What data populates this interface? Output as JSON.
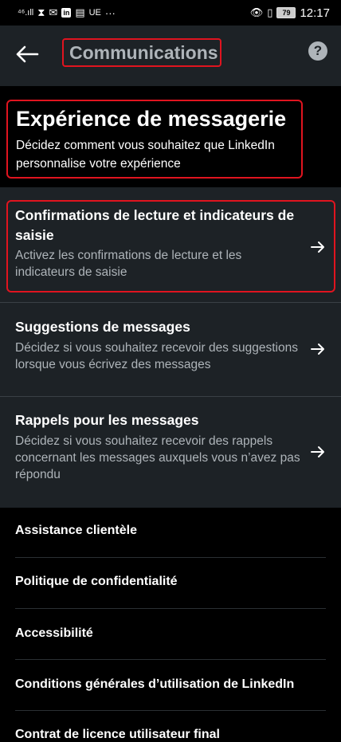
{
  "status_bar": {
    "signal_text": "⁴⁶.ıll",
    "carrier_text": "UE",
    "more": "···",
    "battery": "79",
    "time": "12:17"
  },
  "app_bar": {
    "title": "Communications",
    "back_icon": "arrow-left-icon",
    "help_icon": "question-circle-icon"
  },
  "header": {
    "title": "Expérience de messagerie",
    "description": "Décidez comment vous souhaitez que LinkedIn personnalise votre expérience"
  },
  "settings": [
    {
      "title": "Confirmations de lecture et indicateurs de saisie",
      "description": "Activez les confirmations de lecture et les indicateurs de saisie"
    },
    {
      "title": "Suggestions de messages",
      "description": "Décidez si vous souhaitez recevoir des suggestions lorsque vous écrivez des messages"
    },
    {
      "title": "Rappels pour les messages",
      "description": "Décidez si vous souhaitez recevoir des rappels concernant les messages auxquels vous n’avez pas répondu"
    }
  ],
  "footer_links": [
    "Assistance clientèle",
    "Politique de confidentialité",
    "Accessibilité",
    "Conditions générales d’utilisation de LinkedIn",
    "Contrat de licence utilisateur final"
  ],
  "colors": {
    "highlight": "#e0141f",
    "card_bg": "#1d2226",
    "secondary_text": "#aeb4b9"
  }
}
